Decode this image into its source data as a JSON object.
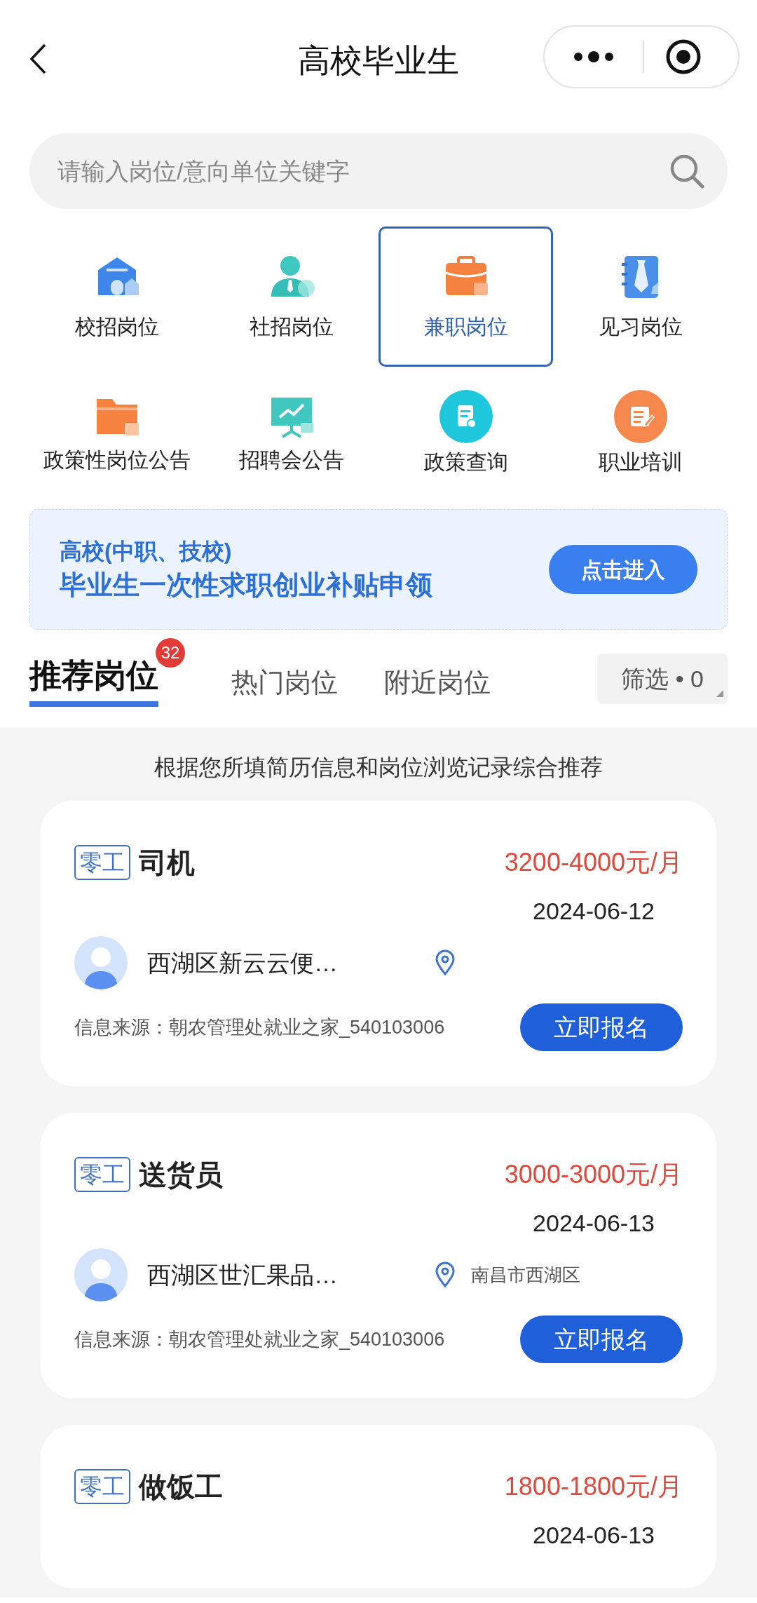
{
  "header": {
    "title": "高校毕业生"
  },
  "search": {
    "placeholder": "请输入岗位/意向单位关键字"
  },
  "categories": [
    {
      "label": "校招岗位",
      "selected": false
    },
    {
      "label": "社招岗位",
      "selected": false
    },
    {
      "label": "兼职岗位",
      "selected": true
    },
    {
      "label": "见习岗位",
      "selected": false
    },
    {
      "label": "政策性岗位公告",
      "selected": false
    },
    {
      "label": "招聘会公告",
      "selected": false
    },
    {
      "label": "政策查询",
      "selected": false
    },
    {
      "label": "职业培训",
      "selected": false
    }
  ],
  "banner": {
    "line_1": "高校(中职、技校)",
    "line_2": "毕业生一次性求职创业补贴申领",
    "button": "点击进入"
  },
  "tabs": [
    {
      "label": "推荐岗位",
      "selected": true,
      "badge": "32"
    },
    {
      "label": "热门岗位",
      "selected": false
    },
    {
      "label": "附近岗位",
      "selected": false
    }
  ],
  "filter": {
    "label": "筛选 • 0"
  },
  "recommend_note": "根据您所填简历信息和岗位浏览记录综合推荐",
  "jobs": [
    {
      "tag": "零工",
      "title": "司机",
      "salary": "3200-4000元/月",
      "date": "2024-06-12",
      "company": "西湖区新云云便…",
      "source": "信息来源：朝农管理处就业之家_540103006",
      "button": "立即报名"
    },
    {
      "tag": "零工",
      "title": "送货员",
      "salary": "3000-3000元/月",
      "date": "2024-06-13",
      "company": "西湖区世汇果品…",
      "location": "南昌市西湖区",
      "source": "信息来源：朝农管理处就业之家_540103006",
      "button": "立即报名"
    },
    {
      "tag": "零工",
      "title": "做饭工",
      "salary": "1800-1800元/月",
      "date": "2024-06-13"
    }
  ]
}
